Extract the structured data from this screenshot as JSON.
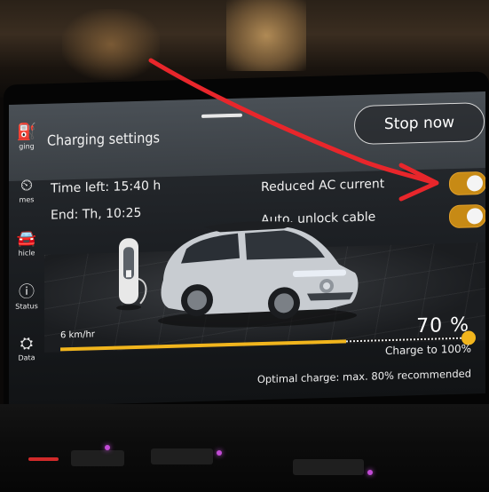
{
  "sidebar": {
    "items": [
      {
        "icon": "charging-plug-icon",
        "label": "ging"
      },
      {
        "icon": "clock-icon",
        "label": "mes"
      },
      {
        "icon": "vehicle-icon",
        "label": "hicle"
      },
      {
        "icon": "info-icon",
        "label": "Status"
      },
      {
        "icon": "data-icon",
        "label": "Data"
      }
    ]
  },
  "header": {
    "title": "Charging settings",
    "stop_button": "Stop now"
  },
  "status": {
    "time_left": "Time left: 15:40 h",
    "end_time": "End: Th, 10:25"
  },
  "options": [
    {
      "label": "Reduced AC current",
      "enabled": true
    },
    {
      "label": "Auto. unlock cable",
      "enabled": true
    }
  ],
  "charge": {
    "speed": "6 km/hr",
    "percent_text": "70 %",
    "current_level": 0.7,
    "target_level": 1.0,
    "target_text": "Charge to 100%",
    "optimal_text": "Optimal charge: max. 80% recommended"
  },
  "colors": {
    "accent": "#f1b51d",
    "toggle_on": "#c78a15",
    "annotation_arrow": "#e8262b"
  }
}
